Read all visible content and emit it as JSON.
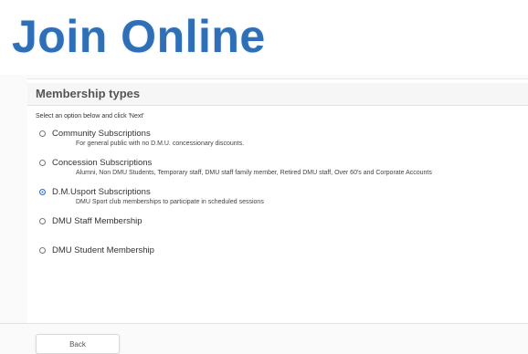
{
  "page": {
    "title": "Join Online"
  },
  "panel": {
    "heading": "Membership types",
    "instruction": "Select an option below and click 'Next'"
  },
  "options": [
    {
      "label": "Community Subscriptions",
      "description": "For general public with no D.M.U. concessionary discounts.",
      "selected": false
    },
    {
      "label": "Concession Subscriptions",
      "description": "Alumni, Non DMU Students, Temporary staff, DMU staff family member, Retired DMU staff, Over 60's and Corporate Accounts",
      "selected": false
    },
    {
      "label": "D.M.Usport Subscriptions",
      "description": "DMU Sport club memberships to participate in scheduled sessions",
      "selected": true
    },
    {
      "label": "DMU Staff Membership",
      "description": "",
      "selected": false
    },
    {
      "label": "DMU Student Membership",
      "description": "",
      "selected": false
    }
  ],
  "footer": {
    "back_label": "Back"
  },
  "colors": {
    "title": "#2e6fb8",
    "radio_selected": "#2b6fd6"
  }
}
